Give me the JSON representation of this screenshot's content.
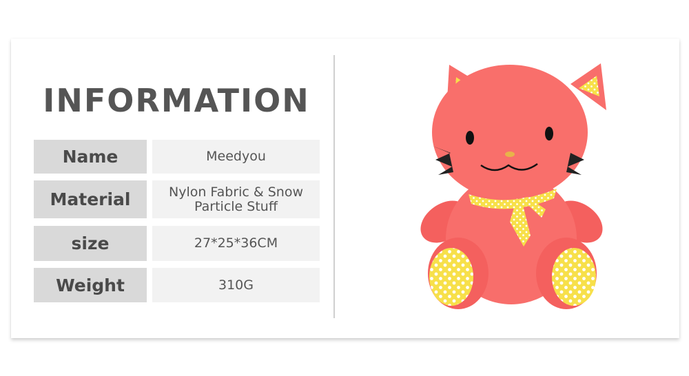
{
  "title": "INFORMATION",
  "specs": [
    {
      "label": "Name",
      "value": "Meedyou"
    },
    {
      "label": "Material",
      "value": "Nylon Fabric & Snow Particle Stuff"
    },
    {
      "label": "size",
      "value": "27*25*36CM"
    },
    {
      "label": "Weight",
      "value": "310G"
    }
  ],
  "colors": {
    "label_bg": "#d9d9d9",
    "value_bg": "#f2f2f2",
    "text": "#555555",
    "plush_body": "#f86e6b",
    "plush_accent": "#f7e04a"
  },
  "product_image": {
    "icon": "plush-cat-illustration"
  }
}
